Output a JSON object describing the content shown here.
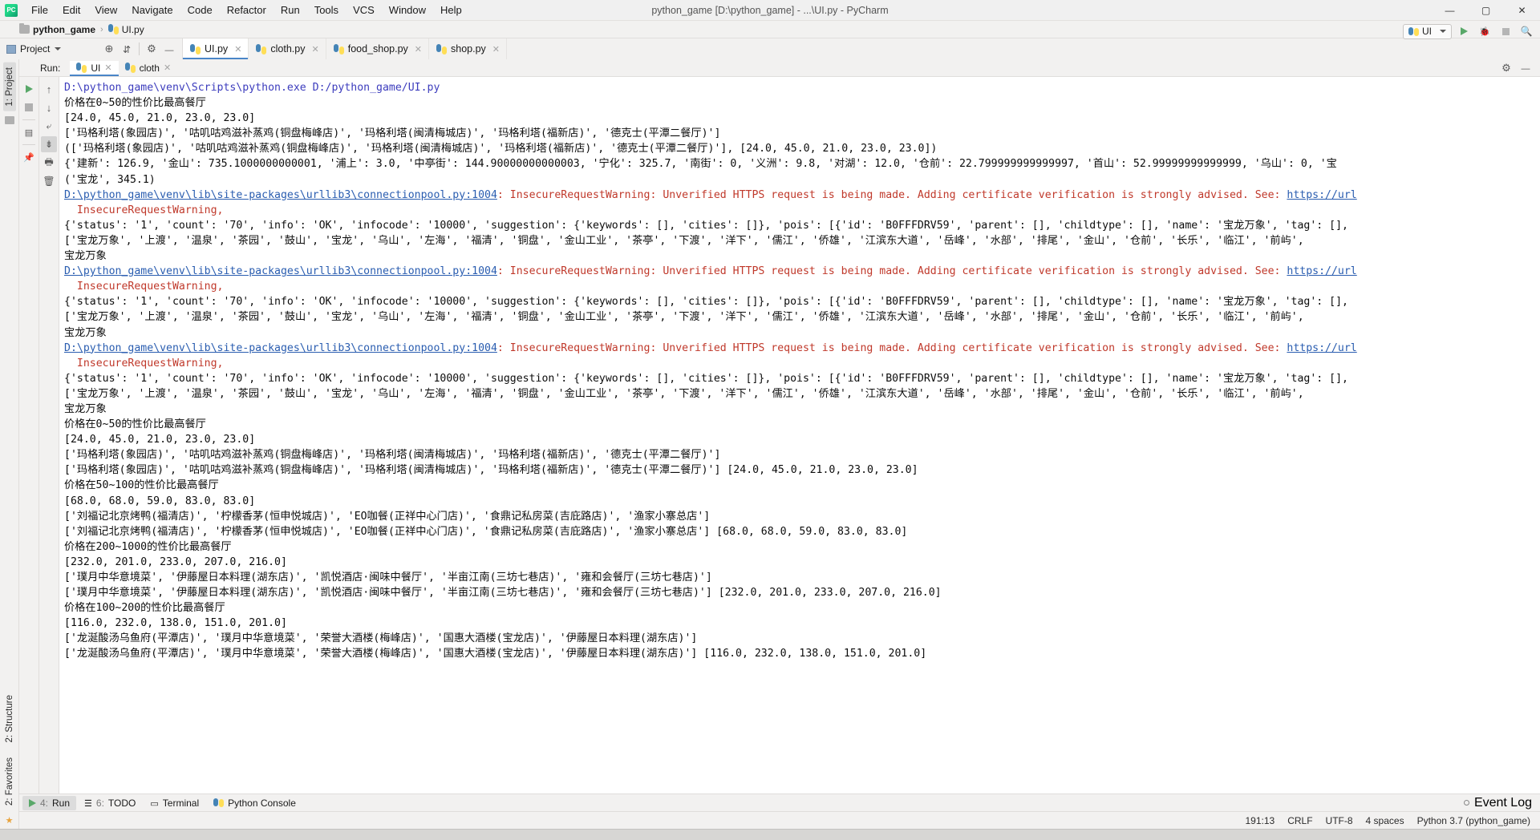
{
  "window": {
    "title": "python_game [D:\\python_game] - ...\\UI.py - PyCharm",
    "minimize": "—",
    "maximize": "▢",
    "close": "✕"
  },
  "menu": [
    {
      "label": "File"
    },
    {
      "label": "Edit"
    },
    {
      "label": "View"
    },
    {
      "label": "Navigate"
    },
    {
      "label": "Code"
    },
    {
      "label": "Refactor"
    },
    {
      "label": "Run"
    },
    {
      "label": "Tools"
    },
    {
      "label": "VCS"
    },
    {
      "label": "Window"
    },
    {
      "label": "Help"
    }
  ],
  "breadcrumb": {
    "project": "python_game",
    "separator": "›",
    "file": "UI.py"
  },
  "toolbar": {
    "project_label": "Project",
    "run_config": "UI",
    "icons": {
      "locate": "target-icon",
      "collapse": "collapse-all-icon",
      "settings": "gear-icon",
      "hide": "hide-icon",
      "run": "run-icon",
      "debug": "debug-icon",
      "stop": "stop-icon",
      "search": "search-icon"
    }
  },
  "editor_tabs": [
    {
      "label": "UI.py",
      "active": true
    },
    {
      "label": "cloth.py",
      "active": false
    },
    {
      "label": "food_shop.py",
      "active": false
    },
    {
      "label": "shop.py",
      "active": false
    }
  ],
  "left_strip": {
    "top": "1: Project",
    "bottom": [
      {
        "label": "2: Structure"
      },
      {
        "label": "2: Favorites"
      }
    ]
  },
  "run_panel": {
    "label": "Run:",
    "tabs": [
      {
        "label": "UI",
        "active": true
      },
      {
        "label": "cloth",
        "active": false
      }
    ],
    "gutter_left": [
      "rerun-icon",
      "stop-icon",
      "console-icon",
      "pin-icon"
    ],
    "gutter_right": [
      "scroll-up-icon",
      "scroll-down-icon",
      "soft-wrap-icon",
      "scroll-to-end-icon",
      "print-icon",
      "clear-all-icon"
    ],
    "settings_icon": "gear-icon",
    "hide_icon": "hide-icon"
  },
  "console": {
    "lines": [
      {
        "t": "cmd",
        "text": "D:\\python_game\\venv\\Scripts\\python.exe D:/python_game/UI.py"
      },
      {
        "t": "out",
        "text": "价格在0~50的性价比最高餐厅"
      },
      {
        "t": "out",
        "text": "[24.0, 45.0, 21.0, 23.0, 23.0]"
      },
      {
        "t": "out",
        "text": "['玛格利塔(象园店)', '咕叽咕鸡滋补蒸鸡(铜盘梅峰店)', '玛格利塔(闽清梅城店)', '玛格利塔(福新店)', '德克士(平潭二餐厅)']"
      },
      {
        "t": "out",
        "text": "(['玛格利塔(象园店)', '咕叽咕鸡滋补蒸鸡(铜盘梅峰店)', '玛格利塔(闽清梅城店)', '玛格利塔(福新店)', '德克士(平潭二餐厅)'], [24.0, 45.0, 21.0, 23.0, 23.0])"
      },
      {
        "t": "out",
        "text": "{'建新': 126.9, '金山': 735.1000000000001, '浦上': 3.0, '中亭街': 144.90000000000003, '宁化': 325.7, '南街': 0, '义洲': 9.8, '对湖': 12.0, '仓前': 22.799999999999997, '首山': 52.99999999999999, '乌山': 0, '宝"
      },
      {
        "t": "out",
        "text": "('宝龙', 345.1)"
      },
      {
        "t": "link",
        "text": "D:\\python_game\\venv\\lib\\site-packages\\urllib3\\connectionpool.py:1004",
        "tail": ": InsecureRequestWarning: Unverified HTTPS request is being made. Adding certificate verification is strongly advised. See: ",
        "tail2": "https://url"
      },
      {
        "t": "warn",
        "text": "  InsecureRequestWarning,"
      },
      {
        "t": "out",
        "text": "{'status': '1', 'count': '70', 'info': 'OK', 'infocode': '10000', 'suggestion': {'keywords': [], 'cities': []}, 'pois': [{'id': 'B0FFFDRV59', 'parent': [], 'childtype': [], 'name': '宝龙万象', 'tag': [],"
      },
      {
        "t": "out",
        "text": "['宝龙万象', '上渡', '温泉', '茶园', '鼓山', '宝龙', '乌山', '左海', '福清', '铜盘', '金山工业', '茶亭', '下渡', '洋下', '儒江', '侨雄', '江滨东大道', '岳峰', '水部', '排尾', '金山', '仓前', '长乐', '临江', '前屿',"
      },
      {
        "t": "out",
        "text": "宝龙万象"
      },
      {
        "t": "link",
        "text": "D:\\python_game\\venv\\lib\\site-packages\\urllib3\\connectionpool.py:1004",
        "tail": ": InsecureRequestWarning: Unverified HTTPS request is being made. Adding certificate verification is strongly advised. See: ",
        "tail2": "https://url"
      },
      {
        "t": "warn",
        "text": "  InsecureRequestWarning,"
      },
      {
        "t": "out",
        "text": "{'status': '1', 'count': '70', 'info': 'OK', 'infocode': '10000', 'suggestion': {'keywords': [], 'cities': []}, 'pois': [{'id': 'B0FFFDRV59', 'parent': [], 'childtype': [], 'name': '宝龙万象', 'tag': [],"
      },
      {
        "t": "out",
        "text": "['宝龙万象', '上渡', '温泉', '茶园', '鼓山', '宝龙', '乌山', '左海', '福清', '铜盘', '金山工业', '茶亭', '下渡', '洋下', '儒江', '侨雄', '江滨东大道', '岳峰', '水部', '排尾', '金山', '仓前', '长乐', '临江', '前屿',"
      },
      {
        "t": "out",
        "text": "宝龙万象"
      },
      {
        "t": "link",
        "text": "D:\\python_game\\venv\\lib\\site-packages\\urllib3\\connectionpool.py:1004",
        "tail": ": InsecureRequestWarning: Unverified HTTPS request is being made. Adding certificate verification is strongly advised. See: ",
        "tail2": "https://url"
      },
      {
        "t": "warn",
        "text": "  InsecureRequestWarning,"
      },
      {
        "t": "out",
        "text": "{'status': '1', 'count': '70', 'info': 'OK', 'infocode': '10000', 'suggestion': {'keywords': [], 'cities': []}, 'pois': [{'id': 'B0FFFDRV59', 'parent': [], 'childtype': [], 'name': '宝龙万象', 'tag': [],"
      },
      {
        "t": "out",
        "text": "['宝龙万象', '上渡', '温泉', '茶园', '鼓山', '宝龙', '乌山', '左海', '福清', '铜盘', '金山工业', '茶亭', '下渡', '洋下', '儒江', '侨雄', '江滨东大道', '岳峰', '水部', '排尾', '金山', '仓前', '长乐', '临江', '前屿',"
      },
      {
        "t": "out",
        "text": "宝龙万象"
      },
      {
        "t": "out",
        "text": "价格在0~50的性价比最高餐厅"
      },
      {
        "t": "out",
        "text": "[24.0, 45.0, 21.0, 23.0, 23.0]"
      },
      {
        "t": "out",
        "text": "['玛格利塔(象园店)', '咕叽咕鸡滋补蒸鸡(铜盘梅峰店)', '玛格利塔(闽清梅城店)', '玛格利塔(福新店)', '德克士(平潭二餐厅)']"
      },
      {
        "t": "out",
        "text": "['玛格利塔(象园店)', '咕叽咕鸡滋补蒸鸡(铜盘梅峰店)', '玛格利塔(闽清梅城店)', '玛格利塔(福新店)', '德克士(平潭二餐厅)'] [24.0, 45.0, 21.0, 23.0, 23.0]"
      },
      {
        "t": "out",
        "text": "价格在50~100的性价比最高餐厅"
      },
      {
        "t": "out",
        "text": "[68.0, 68.0, 59.0, 83.0, 83.0]"
      },
      {
        "t": "out",
        "text": "['刘福记北京烤鸭(福清店)', '柠檬香茅(恒申悦城店)', 'EO咖餐(正祥中心门店)', '食鼎记私房菜(吉庇路店)', '渔家小寨总店']"
      },
      {
        "t": "out",
        "text": "['刘福记北京烤鸭(福清店)', '柠檬香茅(恒申悦城店)', 'EO咖餐(正祥中心门店)', '食鼎记私房菜(吉庇路店)', '渔家小寨总店'] [68.0, 68.0, 59.0, 83.0, 83.0]"
      },
      {
        "t": "out",
        "text": "价格在200~1000的性价比最高餐厅"
      },
      {
        "t": "out",
        "text": "[232.0, 201.0, 233.0, 207.0, 216.0]"
      },
      {
        "t": "out",
        "text": "['璞月中华意境菜', '伊藤屋日本料理(湖东店)', '凯悦酒店·闽味中餐厅', '半亩江南(三坊七巷店)', '雍和会餐厅(三坊七巷店)']"
      },
      {
        "t": "out",
        "text": "['璞月中华意境菜', '伊藤屋日本料理(湖东店)', '凯悦酒店·闽味中餐厅', '半亩江南(三坊七巷店)', '雍和会餐厅(三坊七巷店)'] [232.0, 201.0, 233.0, 207.0, 216.0]"
      },
      {
        "t": "out",
        "text": "价格在100~200的性价比最高餐厅"
      },
      {
        "t": "out",
        "text": "[116.0, 232.0, 138.0, 151.0, 201.0]"
      },
      {
        "t": "out",
        "text": "['龙涎酸汤乌鱼府(平潭店)', '璞月中华意境菜', '荣誉大酒楼(梅峰店)', '国惠大酒楼(宝龙店)', '伊藤屋日本料理(湖东店)']"
      },
      {
        "t": "out",
        "text": "['龙涎酸汤乌鱼府(平潭店)', '璞月中华意境菜', '荣誉大酒楼(梅峰店)', '国惠大酒楼(宝龙店)', '伊藤屋日本料理(湖东店)'] [116.0, 232.0, 138.0, 151.0, 201.0]"
      }
    ]
  },
  "bottom_tools": [
    {
      "num": "4:",
      "label": "Run",
      "icon": "run-icon",
      "selected": true
    },
    {
      "num": "6:",
      "label": "TODO",
      "icon": "todo-icon",
      "selected": false
    },
    {
      "num": "",
      "label": "Terminal",
      "icon": "terminal-icon",
      "selected": false
    },
    {
      "num": "",
      "label": "Python Console",
      "icon": "python-console-icon",
      "selected": false
    }
  ],
  "event_log": "Event Log",
  "statusbar": {
    "caret": "191:13",
    "line_sep": "CRLF",
    "encoding": "UTF-8",
    "indent": "4 spaces",
    "interpreter": "Python 3.7 (python_game)"
  },
  "colors": {
    "accent": "#4a86c8",
    "link": "#2a5db0",
    "command": "#3c3cbd",
    "warning": "#c0392b",
    "chrome": "#f2f1f0",
    "console_bg": "#ffffff"
  }
}
